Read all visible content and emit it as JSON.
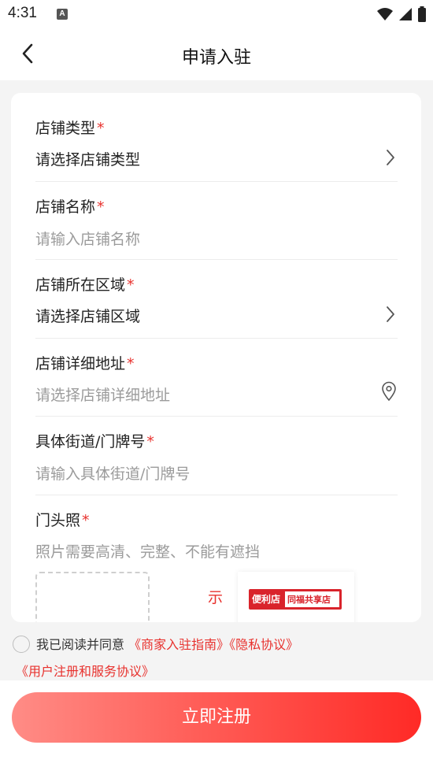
{
  "status_bar": {
    "time": "4:31",
    "notification_icon": "A"
  },
  "nav": {
    "title": "申请入驻"
  },
  "form": {
    "shop_type": {
      "label": "店铺类型",
      "value": "请选择店铺类型"
    },
    "shop_name": {
      "label": "店铺名称",
      "placeholder": "请输入店铺名称"
    },
    "shop_region": {
      "label": "店铺所在区域",
      "value": "请选择店铺区域"
    },
    "shop_address": {
      "label": "店铺详细地址",
      "placeholder": "请选择店铺详细地址"
    },
    "street": {
      "label": "具体街道/门牌号",
      "placeholder": "请输入具体街道/门牌号"
    },
    "storefront_photo": {
      "label": "门头照",
      "hint": "照片需要高清、完整、不能有遮挡",
      "example_label": "示"
    },
    "required_mark": "*"
  },
  "example_sign": {
    "left": "便利店",
    "right": "同福共享店"
  },
  "agreement": {
    "prefix": "我已阅读并同意",
    "link1": "《商家入驻指南》",
    "link2": "《隐私协议》",
    "link3": "《用户注册和服务协议》"
  },
  "submit_label": "立即注册",
  "colors": {
    "accent": "#e8322e",
    "placeholder": "#9b9b9b"
  }
}
